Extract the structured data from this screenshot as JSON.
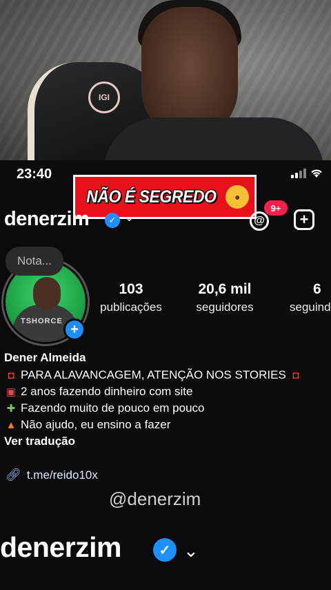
{
  "status_bar": {
    "time": "23:40"
  },
  "caption": {
    "text": "NÃO É SEGREDO",
    "emoji": "shushing-face-emoji"
  },
  "header": {
    "username": "denerzim",
    "notifications_badge": "9+"
  },
  "profile": {
    "note_placeholder": "Nota...",
    "avatar_shirt_text": "TSHORCE",
    "stats": [
      {
        "value": "103",
        "label": "publicações"
      },
      {
        "value": "20,6 mil",
        "label": "seguidores"
      },
      {
        "value": "6",
        "label": "seguindo"
      }
    ],
    "name": "Dener Almeida",
    "bio_lines": [
      {
        "icon": "siren-icon",
        "text": "PARA ALAVANCAGEM, ATENÇÃO NOS STORIES"
      },
      {
        "icon": "slot-machine-icon",
        "text": "2 anos fazendo dinheiro com site"
      },
      {
        "icon": "money-wings-icon",
        "text": "Fazendo muito de pouco em pouco"
      },
      {
        "icon": "fire-icon",
        "text": "Não ajudo, eu ensino a fazer"
      }
    ],
    "translate_label": "Ver tradução",
    "link": "t.me/reido10x"
  },
  "watermark": "@denerzim",
  "footer": {
    "username": "denerzim"
  },
  "colors": {
    "badge": "#ff1f4b",
    "verified": "#1e90ff",
    "caption_bg": "#e8101a"
  }
}
